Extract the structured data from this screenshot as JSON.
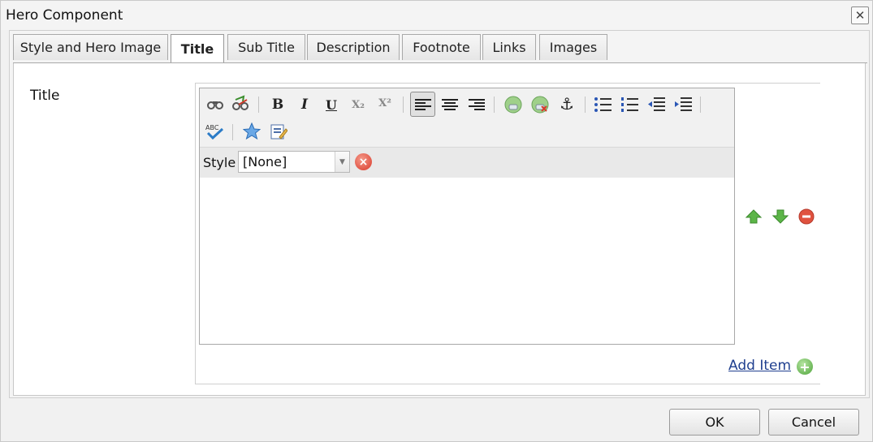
{
  "dialog": {
    "title": "Hero Component",
    "close_glyph": "✕"
  },
  "tabs": [
    {
      "label": "Style and Hero Image",
      "active": false
    },
    {
      "label": "Title",
      "active": true
    },
    {
      "label": "Sub Title",
      "active": false
    },
    {
      "label": "Description",
      "active": false
    },
    {
      "label": "Footnote",
      "active": false
    },
    {
      "label": "Links",
      "active": false
    },
    {
      "label": "Images",
      "active": false
    }
  ],
  "form": {
    "field_label": "Title",
    "style_label": "Style",
    "style_value": "[None]",
    "add_item_label": "Add Item"
  },
  "toolbar_icons": [
    "find-icon",
    "replace-icon",
    "bold-icon",
    "italic-icon",
    "underline-icon",
    "subscript-icon",
    "superscript-icon",
    "align-left-icon",
    "align-center-icon",
    "align-right-icon",
    "link-icon",
    "unlink-icon",
    "anchor-icon",
    "unordered-list-icon",
    "ordered-list-icon",
    "outdent-icon",
    "indent-icon",
    "spellcheck-icon",
    "special-chars-icon",
    "paste-icon"
  ],
  "toolbar_glyphs": {
    "bold": "B",
    "italic": "I",
    "underline": "U",
    "subscript": "X₂",
    "superscript": "X²",
    "anchor": "⚓"
  },
  "buttons": {
    "ok_label": "OK",
    "cancel_label": "Cancel"
  },
  "colors": {
    "link": "#1f3f8f",
    "accent_green": "#4ea33a",
    "accent_red": "#d9392a"
  }
}
